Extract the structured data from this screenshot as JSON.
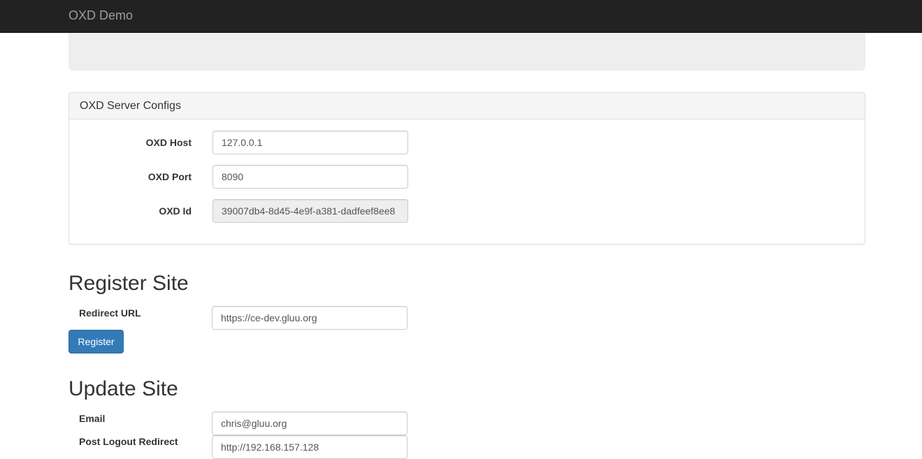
{
  "navbar": {
    "brand": "OXD Demo"
  },
  "server_configs": {
    "title": "OXD Server Configs",
    "host_label": "OXD Host",
    "host_value": "127.0.0.1",
    "port_label": "OXD Port",
    "port_value": "8090",
    "id_label": "OXD Id",
    "id_value": "39007db4-8d45-4e9f-a381-dadfeef8ee8"
  },
  "register_site": {
    "heading": "Register Site",
    "redirect_label": "Redirect URL",
    "redirect_value": "https://ce-dev.gluu.org",
    "register_button": "Register"
  },
  "update_site": {
    "heading": "Update Site",
    "email_label": "Email",
    "email_value": "chris@gluu.org",
    "post_logout_label": "Post Logout Redirect",
    "post_logout_value": "http://192.168.157.128"
  }
}
